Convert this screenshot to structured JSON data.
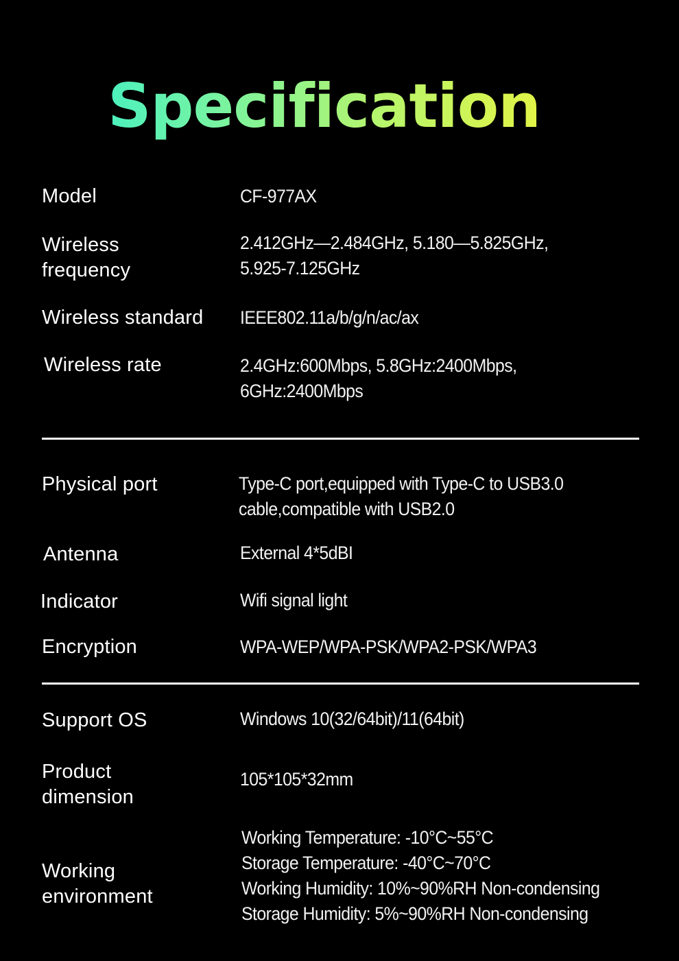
{
  "title": "Specification",
  "colors": {
    "background": "#000000",
    "text": "#ffffff",
    "title_gradient_start": "#22eed8",
    "title_gradient_end": "#fff42e",
    "divider": "#ffffff"
  },
  "specs": [
    {
      "label": "Model",
      "value_lines": [
        "CF-977AX"
      ]
    },
    {
      "label_lines": [
        "Wireless",
        "frequency"
      ],
      "value_lines": [
        "2.412GHz—2.484GHz,  5.180—5.825GHz,",
        "5.925-7.125GHz"
      ]
    },
    {
      "label": "Wireless standard",
      "value_lines": [
        "IEEE802.11a/b/g/n/ac/ax"
      ]
    },
    {
      "label": "Wireless rate",
      "value_lines": [
        "2.4GHz:600Mbps, 5.8GHz:2400Mbps,",
        "6GHz:2400Mbps"
      ]
    },
    {
      "label": "Physical port",
      "value_lines": [
        "Type-C port,equipped with Type-C to USB3.0",
        "cable,compatible with USB2.0"
      ]
    },
    {
      "label": "Antenna",
      "value_lines": [
        "External 4*5dBI"
      ]
    },
    {
      "label": "Indicator",
      "value_lines": [
        "Wifi signal light"
      ]
    },
    {
      "label": "Encryption",
      "value_lines": [
        "WPA-WEP/WPA-PSK/WPA2-PSK/WPA3"
      ]
    },
    {
      "label": "Support OS",
      "value_lines": [
        "Windows 10(32/64bit)/11(64bit)"
      ]
    },
    {
      "label_lines": [
        "Product",
        "dimension"
      ],
      "value_lines": [
        "105*105*32mm"
      ]
    },
    {
      "label_lines": [
        "Working",
        "environment"
      ],
      "value_lines": [
        "Working Temperature: -10°C~55°C",
        "Storage Temperature: -40°C~70°C",
        "Working Humidity: 10%~90%RH Non-condensing",
        "Storage Humidity: 5%~90%RH Non-condensing"
      ]
    }
  ]
}
